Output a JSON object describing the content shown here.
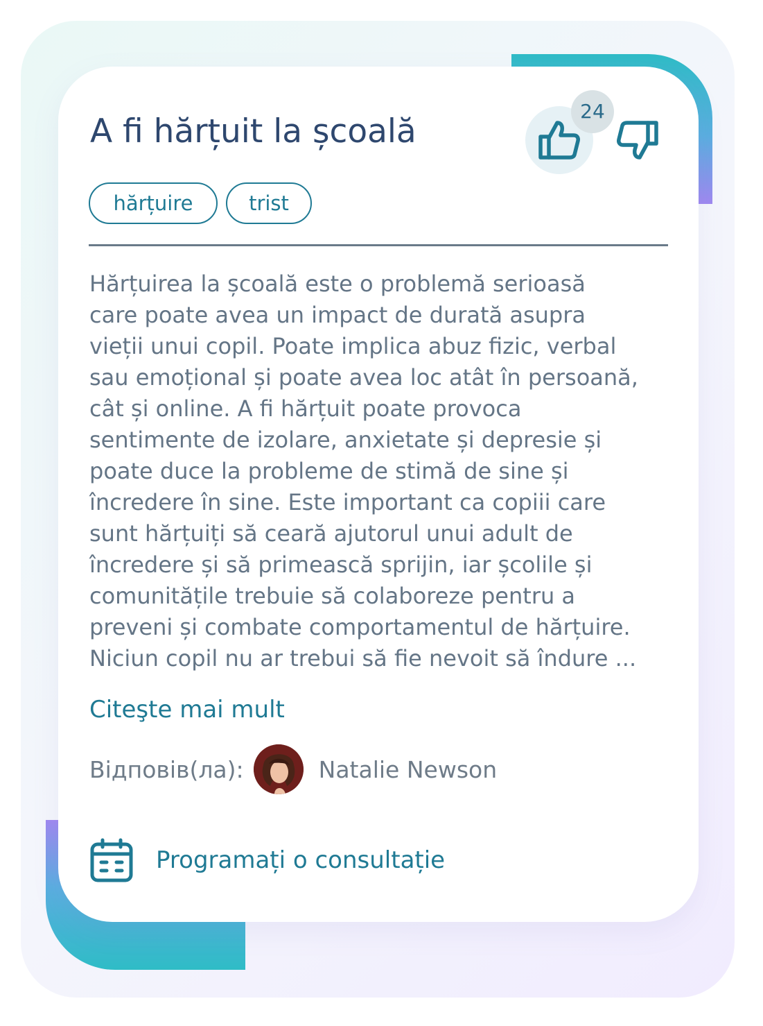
{
  "card": {
    "title": "A fi hărțuit la școală",
    "tags": [
      "hărțuire",
      "trist"
    ],
    "likes": {
      "count": "24",
      "up_icon": "thumbs-up-icon",
      "down_icon": "thumbs-down-icon"
    },
    "body_lines": [
      "Hărțuirea la școală este o problemă serioasă",
      "care poate avea un impact de durată asupra",
      "vieții unui copil. Poate implica abuz fizic, verbal",
      "sau emoțional și poate avea loc atât în persoană,",
      "cât și online. A fi hărțuit poate provoca",
      "sentimente de izolare, anxietate și depresie și",
      "poate duce la probleme de stimă de sine și",
      "încredere în sine. Este important ca copiii care",
      "sunt hărțuiți să ceară ajutorul unui adult de",
      "încredere și să primească sprijin, iar școlile și",
      "comunitățile trebuie să colaboreze pentru a",
      "preveni și combate comportamentul de hărțuire.",
      "Niciun copil nu ar trebui să fie nevoit să îndure ..."
    ],
    "read_more": "Citeşte mai mult",
    "answered_label": "Відповів(ла):",
    "author_name": "Natalie Newson",
    "cta_label": "Programați o consultație",
    "cta_icon": "calendar-icon",
    "colors": {
      "primary": "#1f7a94",
      "title": "#2e476e",
      "text": "#647586",
      "accent_teal": "#2fbcc6",
      "accent_violet": "#9f88f0"
    }
  }
}
